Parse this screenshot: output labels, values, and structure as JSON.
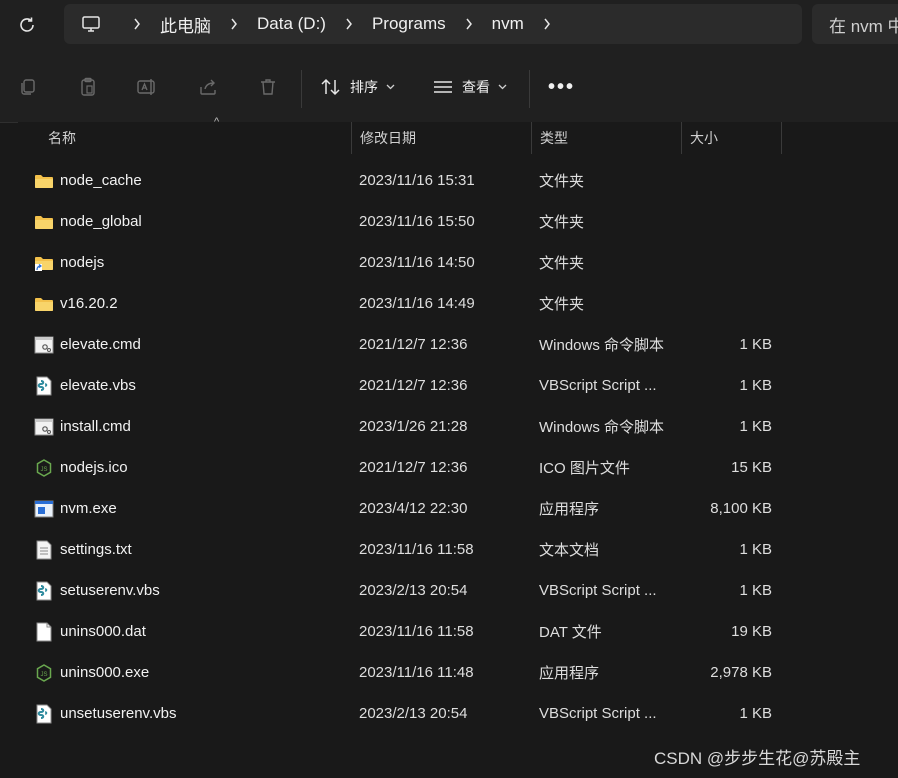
{
  "address": {
    "crumbs": [
      "此电脑",
      "Data (D:)",
      "Programs",
      "nvm"
    ],
    "search_placeholder": "在 nvm 中"
  },
  "toolbar": {
    "sort_label": "排序",
    "view_label": "查看",
    "more_label": "•••"
  },
  "columns": {
    "name": "名称",
    "date": "修改日期",
    "type": "类型",
    "size": "大小"
  },
  "files": [
    {
      "name": "node_cache",
      "date": "2023/11/16 15:31",
      "type": "文件夹",
      "size": "",
      "icon": "folder-icon"
    },
    {
      "name": "node_global",
      "date": "2023/11/16 15:50",
      "type": "文件夹",
      "size": "",
      "icon": "folder-icon"
    },
    {
      "name": "nodejs",
      "date": "2023/11/16 14:50",
      "type": "文件夹",
      "size": "",
      "icon": "folder-shortcut-icon"
    },
    {
      "name": "v16.20.2",
      "date": "2023/11/16 14:49",
      "type": "文件夹",
      "size": "",
      "icon": "folder-icon"
    },
    {
      "name": "elevate.cmd",
      "date": "2021/12/7 12:36",
      "type": "Windows 命令脚本",
      "size": "1 KB",
      "icon": "cmd-file-icon"
    },
    {
      "name": "elevate.vbs",
      "date": "2021/12/7 12:36",
      "type": "VBScript Script ...",
      "size": "1 KB",
      "icon": "vbs-file-icon"
    },
    {
      "name": "install.cmd",
      "date": "2023/1/26 21:28",
      "type": "Windows 命令脚本",
      "size": "1 KB",
      "icon": "cmd-file-icon"
    },
    {
      "name": "nodejs.ico",
      "date": "2021/12/7 12:36",
      "type": "ICO 图片文件",
      "size": "15 KB",
      "icon": "nodejs-icon"
    },
    {
      "name": "nvm.exe",
      "date": "2023/4/12 22:30",
      "type": "应用程序",
      "size": "8,100 KB",
      "icon": "exe-file-icon"
    },
    {
      "name": "settings.txt",
      "date": "2023/11/16 11:58",
      "type": "文本文档",
      "size": "1 KB",
      "icon": "text-file-icon"
    },
    {
      "name": "setuserenv.vbs",
      "date": "2023/2/13 20:54",
      "type": "VBScript Script ...",
      "size": "1 KB",
      "icon": "vbs-file-icon"
    },
    {
      "name": "unins000.dat",
      "date": "2023/11/16 11:58",
      "type": "DAT 文件",
      "size": "19 KB",
      "icon": "blank-file-icon"
    },
    {
      "name": "unins000.exe",
      "date": "2023/11/16 11:48",
      "type": "应用程序",
      "size": "2,978 KB",
      "icon": "nodejs-icon"
    },
    {
      "name": "unsetuserenv.vbs",
      "date": "2023/2/13 20:54",
      "type": "VBScript Script ...",
      "size": "1 KB",
      "icon": "vbs-file-icon"
    }
  ],
  "watermark": "CSDN @步步生花@苏殿主"
}
